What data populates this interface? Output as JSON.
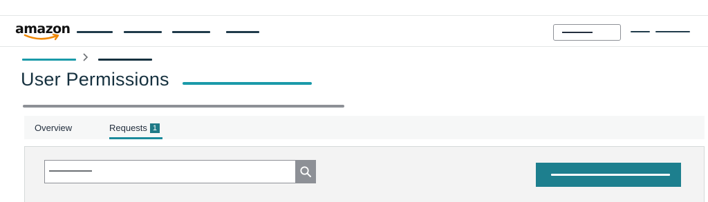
{
  "brand": {
    "logo_text": "amazon",
    "logo_color": "#111111",
    "smile_color": "#f08804"
  },
  "header": {
    "nav_items": [
      "",
      "",
      "",
      ""
    ],
    "search_value": "",
    "account_links": [
      "",
      ""
    ]
  },
  "breadcrumb": {
    "items": [
      "",
      ""
    ],
    "separator_icon": "chevron-right-icon"
  },
  "page": {
    "title": "User Permissions",
    "title_link": "",
    "subtitle": ""
  },
  "tabs": [
    {
      "label": "Overview",
      "selected": false
    },
    {
      "label": "Requests",
      "badge": "1",
      "selected": true
    }
  ],
  "toolbar": {
    "search_placeholder": "",
    "search_icon": "magnifier-icon",
    "primary_action_label": ""
  },
  "colors": {
    "accent": "#1a9aa9",
    "nav_dark": "#1f3a4a",
    "badge": "#1f7a87",
    "primary_button": "#1d7f8e",
    "search_button": "#8d9096"
  }
}
